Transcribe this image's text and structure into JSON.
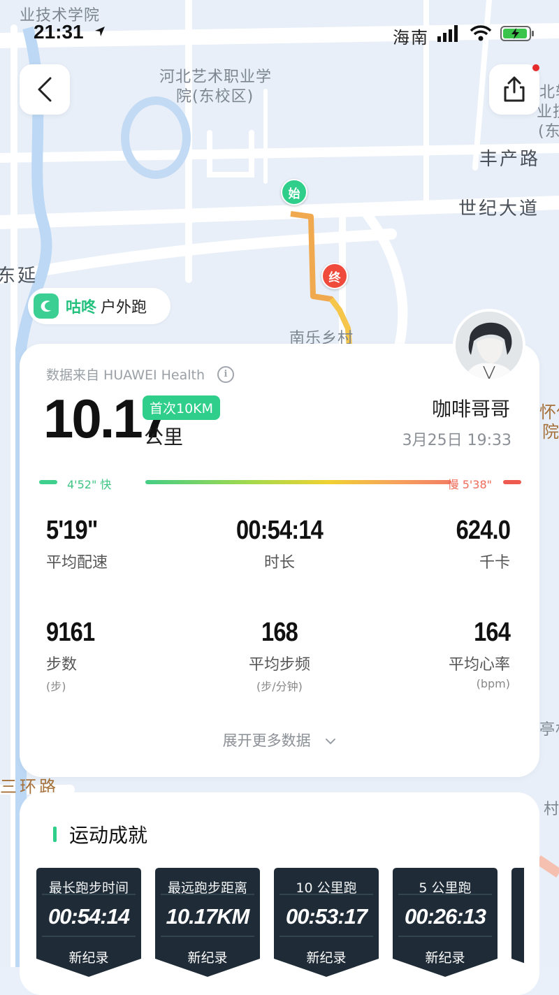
{
  "status": {
    "time": "21:31",
    "carrier": "海南"
  },
  "map": {
    "labels": [
      "业技术学院",
      "河北艺术职业学",
      "院(东校区)",
      "丰产路",
      "世纪大道",
      "东延",
      "南乐乡村",
      "三环路",
      "北轴",
      "业技",
      "(东",
      "怀仁",
      "院",
      "亭村",
      "村"
    ],
    "start_pin": "始",
    "end_pin": "终"
  },
  "brand": {
    "name": "咕咚",
    "mode": "户外跑",
    "icon": "codoon-logo-icon"
  },
  "summary": {
    "source": "数据来自 HUAWEI Health",
    "distance": "10.17",
    "badge": "首次10KM",
    "unit": "公里",
    "user_name": "咖啡哥哥",
    "datetime": "3月25日 19:33",
    "pace_fast": "4'52\" 快",
    "pace_slow": "慢 5'38\""
  },
  "stats": [
    {
      "value": "5'19\"",
      "label": "平均配速",
      "sub": ""
    },
    {
      "value": "00:54:14",
      "label": "时长",
      "sub": ""
    },
    {
      "value": "624.0",
      "label": "千卡",
      "sub": ""
    },
    {
      "value": "9161",
      "label": "步数",
      "sub": "(步)"
    },
    {
      "value": "168",
      "label": "平均步频",
      "sub": "(步/分钟)"
    },
    {
      "value": "164",
      "label": "平均心率",
      "sub": "(bpm)"
    }
  ],
  "expand_label": "展开更多数据",
  "achievements": {
    "title": "运动成就",
    "items": [
      {
        "title": "最长跑步时间",
        "value": "00:54:14",
        "record": "新纪录"
      },
      {
        "title": "最远跑步距离",
        "value": "10.17KM",
        "record": "新纪录"
      },
      {
        "title": "10 公里跑",
        "value": "00:53:17",
        "record": "新纪录"
      },
      {
        "title": "5 公里跑",
        "value": "00:26:13",
        "record": "新纪录"
      }
    ]
  },
  "colors": {
    "accent": "#2fce8a",
    "route_start": "#f0a94e",
    "route_end": "#f6c64a",
    "end_pin": "#ef4a3c",
    "medal": "#1f2c37"
  }
}
